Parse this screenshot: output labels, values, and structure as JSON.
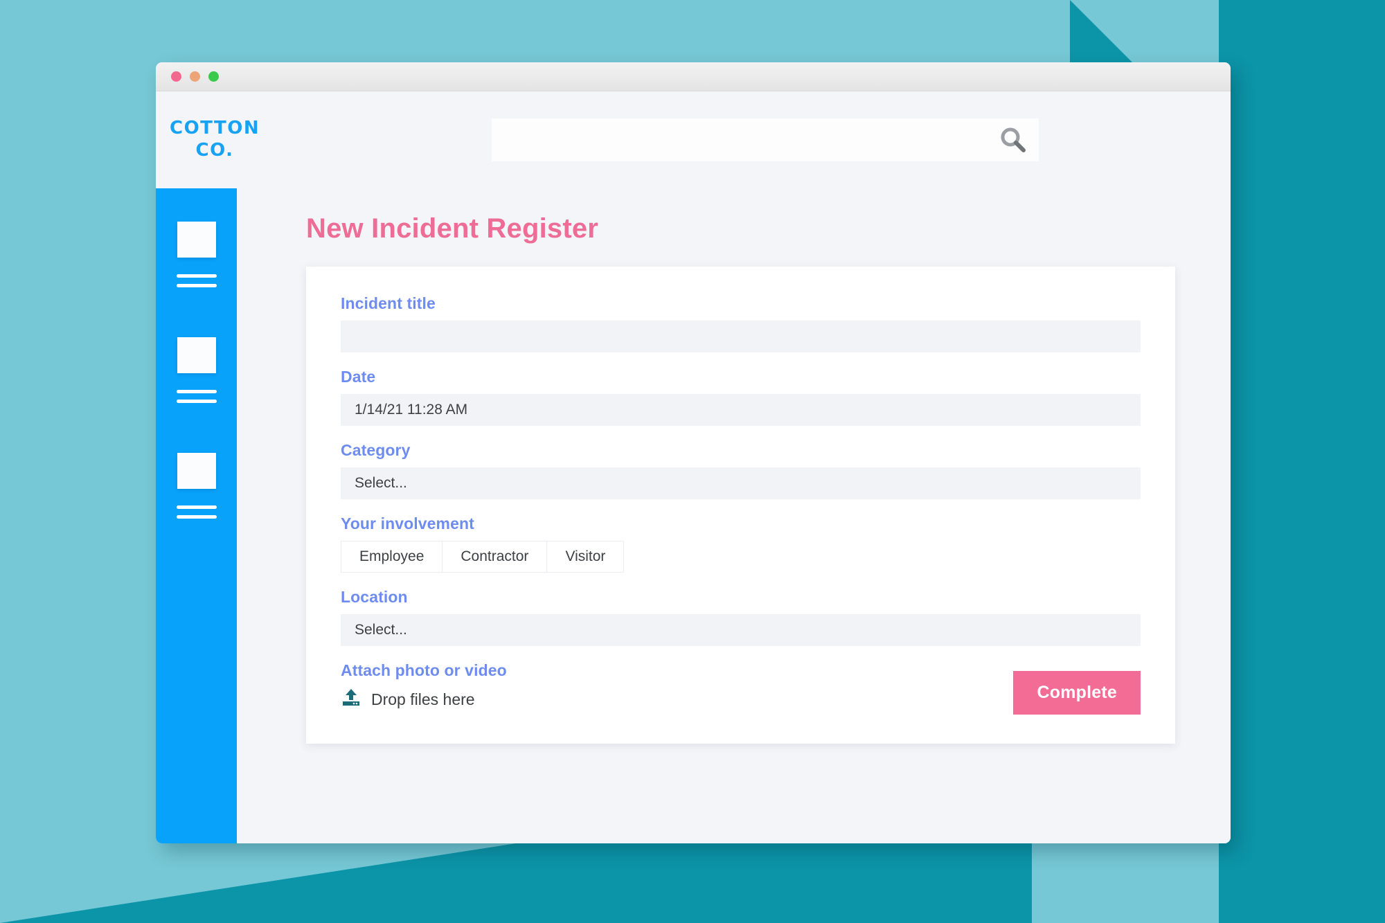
{
  "window": {
    "traffic_lights": [
      "close",
      "minimize",
      "maximize"
    ]
  },
  "header": {
    "logo_line1": "COTTON",
    "logo_line2": "CO.",
    "logo_color": "#17a2f3",
    "search": {
      "value": "",
      "placeholder": "",
      "icon": "search-icon"
    },
    "menu_icon": "hamburger-menu-icon",
    "avatar_alt": "user-avatar"
  },
  "sidebar": {
    "background": "#08a2fb",
    "items": [
      {
        "icon": "nav-placeholder-icon"
      },
      {
        "icon": "nav-placeholder-icon"
      },
      {
        "icon": "nav-placeholder-icon"
      }
    ]
  },
  "main": {
    "page_title": "New Incident Register",
    "title_color": "#ee6d96",
    "form": {
      "fields": [
        {
          "label": "Incident title",
          "type": "text",
          "value": "",
          "placeholder": ""
        },
        {
          "label": "Date",
          "type": "text",
          "value": "1/14/21 11:28 AM",
          "placeholder": ""
        },
        {
          "label": "Category",
          "type": "select",
          "value": "Select...",
          "placeholder": "Select..."
        }
      ],
      "involvement": {
        "label": "Your involvement",
        "options": [
          "Employee",
          "Contractor",
          "Visitor"
        ],
        "selected": ""
      },
      "location": {
        "label": "Location",
        "type": "select",
        "value": "Select...",
        "placeholder": "Select..."
      },
      "attach": {
        "label": "Attach photo or video",
        "dropzone_text": "Drop files here",
        "upload_icon": "upload-icon",
        "icon_color": "#1c6b78"
      },
      "submit": {
        "label": "Complete",
        "color": "#f26c96"
      }
    }
  },
  "background": {
    "base_color": "#76c8d6",
    "accent_color": "#0c94a8"
  }
}
